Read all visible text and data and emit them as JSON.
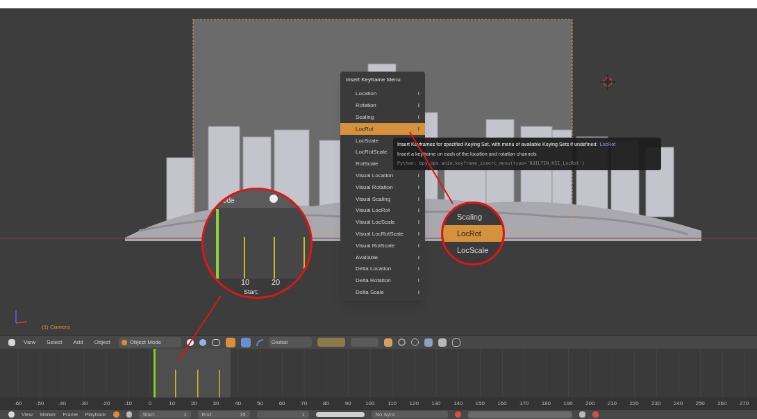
{
  "viewport": {
    "object_label": "(1) Camera"
  },
  "menu": {
    "title": "Insert Keyframe Menu",
    "items": [
      {
        "label": "Location",
        "shortcut": "I",
        "selected": false
      },
      {
        "label": "Rotation",
        "shortcut": "I",
        "selected": false
      },
      {
        "label": "Scaling",
        "shortcut": "I",
        "selected": false
      },
      {
        "label": "LocRot",
        "shortcut": "I",
        "selected": true
      },
      {
        "label": "LocScale",
        "selected": false
      },
      {
        "label": "LocRotScale",
        "selected": false
      },
      {
        "label": "RotScale",
        "selected": false
      },
      {
        "label": "Visual Location",
        "shortcut": "I",
        "selected": false
      },
      {
        "label": "Visual Rotation",
        "shortcut": "I",
        "selected": false
      },
      {
        "label": "Visual Scaling",
        "shortcut": "I",
        "selected": false
      },
      {
        "label": "Visual LocRot",
        "shortcut": "I",
        "selected": false
      },
      {
        "label": "Visual LocScale",
        "shortcut": "I",
        "selected": false
      },
      {
        "label": "Visual LocRotScale",
        "shortcut": "I",
        "selected": false
      },
      {
        "label": "Visual RotScale",
        "shortcut": "I",
        "selected": false
      },
      {
        "label": "Available",
        "shortcut": "I",
        "selected": false
      },
      {
        "label": "Delta Location",
        "shortcut": "I",
        "selected": false
      },
      {
        "label": "Delta Rotation",
        "shortcut": "I",
        "selected": false
      },
      {
        "label": "Delta Scale",
        "shortcut": "I",
        "selected": false
      }
    ]
  },
  "tooltip": {
    "description": "Insert Keyframes for specified Keying Set, with menu of available Keying Sets if undefined:",
    "value": "LocRot",
    "detail": "Insert a keyframe on each of the location and rotation channels",
    "python": "Python: bpy.ops.anim.keyframe_insert_menu(type='BUILTIN_KSI_LocRot')"
  },
  "zoom_timeline": {
    "mode_label": "ode",
    "ticks": [
      "10",
      "20"
    ],
    "start_label": "Start:"
  },
  "zoom_menu": {
    "items": [
      {
        "label": "Scaling",
        "selected": false
      },
      {
        "label": "LocRot",
        "selected": true
      },
      {
        "label": "LocScale",
        "selected": false
      }
    ]
  },
  "toolbar": {
    "menus": [
      "View",
      "Select",
      "Add",
      "Object"
    ],
    "mode": "Object Mode",
    "orientation": "Global"
  },
  "timeline": {
    "ruler": [
      "-60",
      "-50",
      "-40",
      "-30",
      "-20",
      "-10",
      "0",
      "10",
      "20",
      "30",
      "40",
      "50",
      "60",
      "70",
      "80",
      "90",
      "100",
      "110",
      "120",
      "130",
      "140",
      "150",
      "160",
      "170",
      "180",
      "190",
      "200",
      "210",
      "220",
      "230",
      "240",
      "250",
      "260",
      "270"
    ]
  },
  "playback_bar": {
    "menus": [
      "View",
      "Marker",
      "Frame",
      "Playback"
    ],
    "start_label": "Start:",
    "start": "1",
    "end_label": "End:",
    "end": "35",
    "current": "1",
    "sync": "No Sync"
  }
}
